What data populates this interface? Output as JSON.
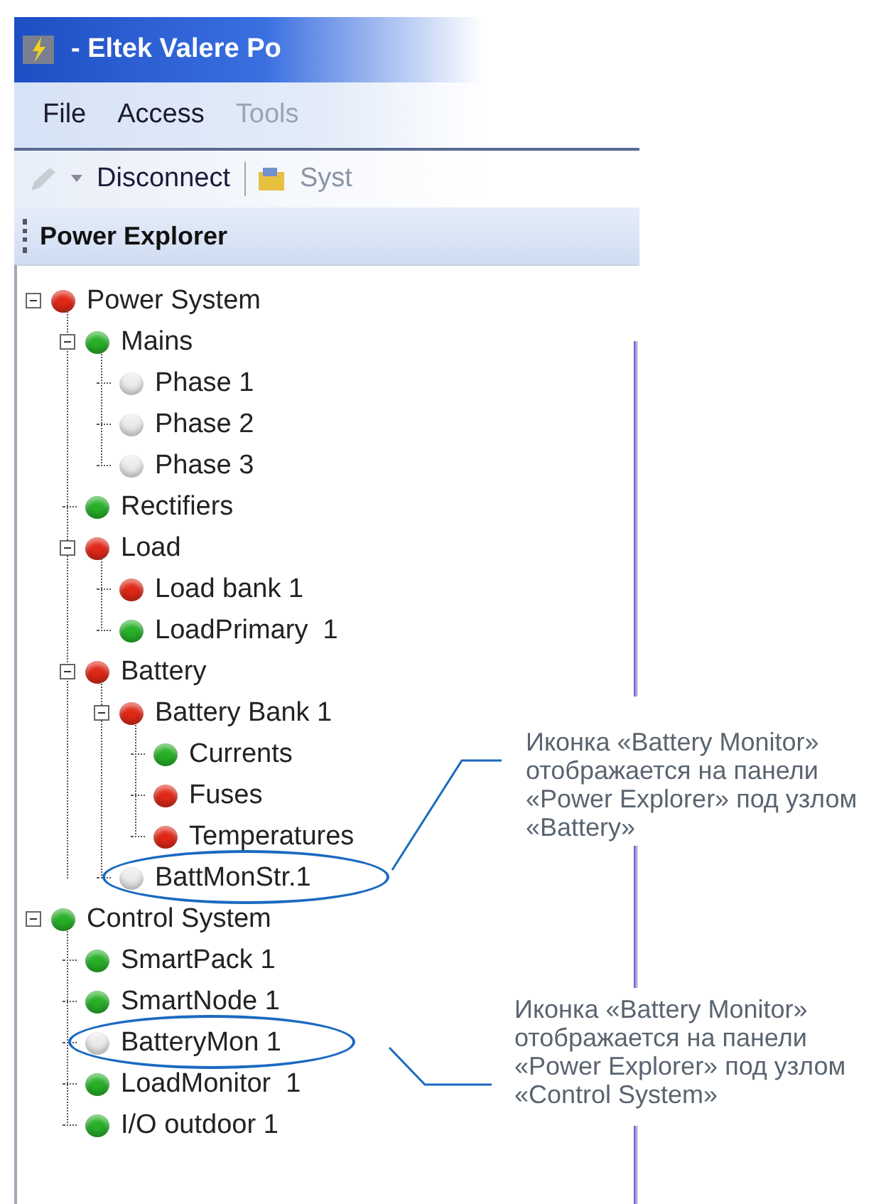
{
  "window": {
    "title": "- Eltek Valere Po"
  },
  "menu": [
    "File",
    "Access",
    "Tools"
  ],
  "toolbar": {
    "disconnect": "Disconnect",
    "system": "Syst"
  },
  "panel": {
    "title": "Power Explorer"
  },
  "tree": [
    {
      "label": "Power System",
      "color": "#e02818",
      "expanded": true,
      "circled": false,
      "children": [
        {
          "label": "Mains",
          "color": "#28b028",
          "expanded": true,
          "circled": false,
          "children": [
            {
              "label": "Phase 1",
              "color": "#ececec",
              "circled": false
            },
            {
              "label": "Phase 2",
              "color": "#ececec",
              "circled": false
            },
            {
              "label": "Phase 3",
              "color": "#ececec",
              "circled": false
            }
          ]
        },
        {
          "label": "Rectifiers",
          "color": "#28b028",
          "circled": false
        },
        {
          "label": "Load",
          "color": "#e02818",
          "expanded": true,
          "circled": false,
          "children": [
            {
              "label": "Load bank 1",
              "color": "#e02818",
              "circled": false
            },
            {
              "label": "LoadPrimary  1",
              "color": "#28b028",
              "circled": false
            }
          ]
        },
        {
          "label": "Battery",
          "color": "#e02818",
          "expanded": true,
          "circled": false,
          "children": [
            {
              "label": "Battery Bank 1",
              "color": "#e02818",
              "expanded": true,
              "circled": false,
              "children": [
                {
                  "label": "Currents",
                  "color": "#28b028",
                  "circled": false
                },
                {
                  "label": "Fuses",
                  "color": "#e02818",
                  "circled": false
                },
                {
                  "label": "Temperatures",
                  "color": "#e02818",
                  "circled": false
                }
              ]
            },
            {
              "label": "BattMonStr.1",
              "color": "#ececec",
              "circled": true
            }
          ]
        }
      ]
    },
    {
      "label": "Control System",
      "color": "#28b028",
      "expanded": true,
      "circled": false,
      "children": [
        {
          "label": "SmartPack 1",
          "color": "#28b028",
          "circled": false
        },
        {
          "label": "SmartNode 1",
          "color": "#28b028",
          "circled": false
        },
        {
          "label": "BatteryMon 1",
          "color": "#ececec",
          "circled": true
        },
        {
          "label": "LoadMonitor  1",
          "color": "#28b028",
          "circled": false
        },
        {
          "label": "I/O outdoor 1",
          "color": "#28b028",
          "circled": false
        }
      ]
    }
  ],
  "callouts": [
    "Иконка «Battery Monitor» отображается на панели «Power Explorer» под узлом «Battery»",
    "Иконка «Battery Monitor» отображается на панели «Power Explorer» под узлом «Control System»"
  ]
}
